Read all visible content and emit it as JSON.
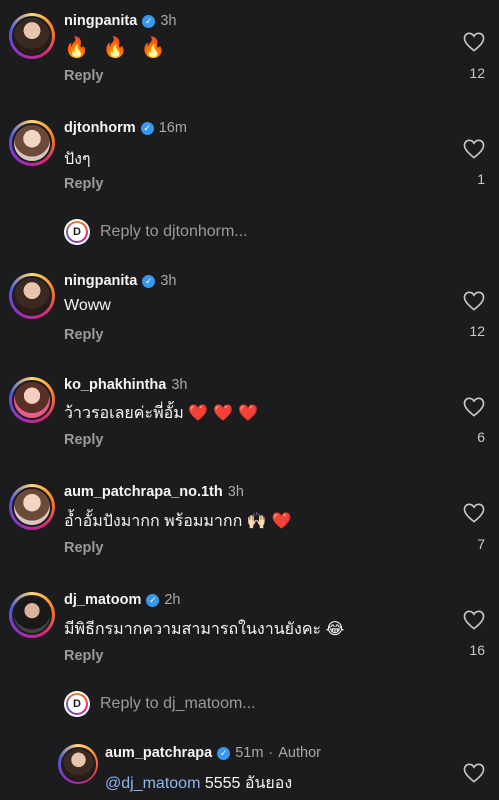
{
  "comments": [
    {
      "username": "ningpanita",
      "time": "3h",
      "text": "🔥 🔥 🔥",
      "reply": "Reply",
      "likes": "12"
    },
    {
      "username": "djtonhorm",
      "time": "16m",
      "text": "ปังๆ",
      "reply": "Reply",
      "likes": "1",
      "thread": "Reply to djtonhorm..."
    },
    {
      "username": "ningpanita",
      "time": "3h",
      "text": "Woww",
      "reply": "Reply",
      "likes": "12"
    },
    {
      "username": "ko_phakhintha",
      "time": "3h",
      "text": "ว้าวรอเลยค่ะพี่อั้ม",
      "emoji": "❤️ ❤️ ❤️",
      "reply": "Reply",
      "likes": "6"
    },
    {
      "username": "aum_patchrapa_no.1th",
      "time": "3h",
      "text": "อ้ำอั้มปังมากก พร้อมมากก",
      "emoji": "🙌🏻 ❤️",
      "reply": "Reply",
      "likes": "7"
    },
    {
      "username": "dj_matoom",
      "time": "2h",
      "text": "มีพิธีกรมากความสามารถในงานยังคะ",
      "emoji": "😂",
      "reply": "Reply",
      "likes": "16",
      "thread": "Reply to dj_matoom..."
    }
  ],
  "nested_reply": {
    "username": "aum_patchrapa",
    "time": "51m",
    "author_label": "Author",
    "mention": "@dj_matoom",
    "text": "5555 อันยอง"
  },
  "icons": {
    "like": "heart-outline-icon",
    "verified": "verified-badge-icon",
    "thread": "reply-avatar-icon"
  },
  "colors": {
    "background": "#1c1c1e",
    "verified": "#3897f0",
    "mention": "#8fb5ef"
  }
}
